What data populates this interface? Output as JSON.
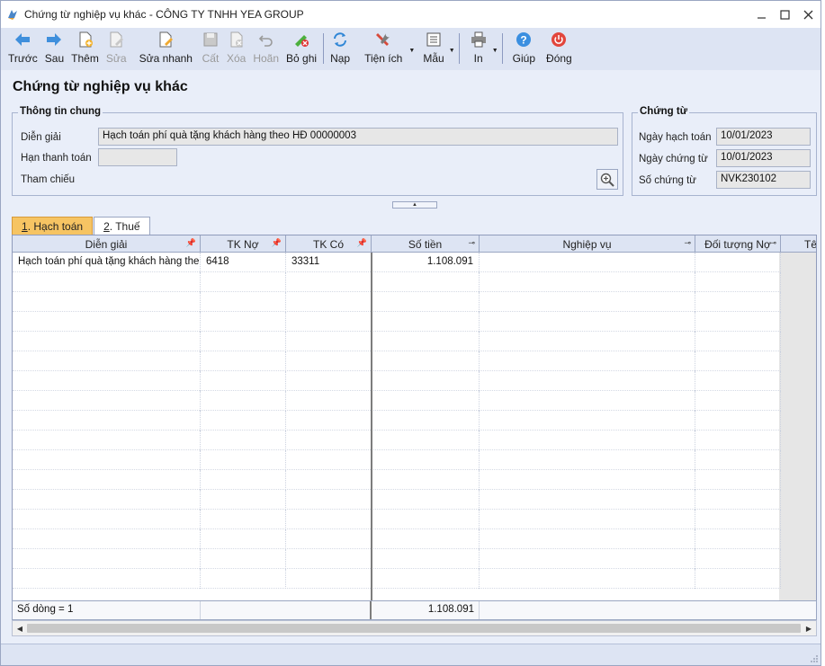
{
  "window": {
    "title": "Chứng từ nghiệp vụ khác - CÔNG TY TNHH YEA GROUP"
  },
  "toolbar": [
    {
      "key": "prev",
      "label": "Trước",
      "icon": "arrow-left-icon",
      "disabled": false
    },
    {
      "key": "next",
      "label": "Sau",
      "icon": "arrow-right-icon",
      "disabled": false
    },
    {
      "key": "add",
      "label": "Thêm",
      "icon": "new-document-icon",
      "disabled": false
    },
    {
      "key": "edit",
      "label": "Sửa",
      "icon": "edit-document-icon",
      "disabled": true
    },
    {
      "key": "quick-edit",
      "label": "Sửa nhanh",
      "icon": "quick-edit-icon",
      "disabled": false
    },
    {
      "key": "save",
      "label": "Cất",
      "icon": "save-icon",
      "disabled": true
    },
    {
      "key": "delete",
      "label": "Xóa",
      "icon": "delete-icon",
      "disabled": true
    },
    {
      "key": "undo",
      "label": "Hoãn",
      "icon": "undo-icon",
      "disabled": true
    },
    {
      "key": "unpost",
      "label": "Bỏ ghi",
      "icon": "unpost-icon",
      "disabled": false
    },
    {
      "key": "reload",
      "label": "Nạp",
      "icon": "refresh-icon",
      "disabled": false
    },
    {
      "key": "utilities",
      "label": "Tiện ích",
      "icon": "tools-icon",
      "disabled": false
    },
    {
      "key": "template",
      "label": "Mẫu",
      "icon": "template-icon",
      "disabled": false
    },
    {
      "key": "print",
      "label": "In",
      "icon": "printer-icon",
      "disabled": false
    },
    {
      "key": "help",
      "label": "Giúp",
      "icon": "help-icon",
      "disabled": false
    },
    {
      "key": "close",
      "label": "Đóng",
      "icon": "power-icon",
      "disabled": false
    }
  ],
  "page": {
    "title": "Chứng từ nghiệp vụ khác"
  },
  "general_info": {
    "legend": "Thông tin chung",
    "description_label": "Diễn giải",
    "description_value": "Hạch toán phí quà tặng khách hàng theo HĐ 00000003",
    "payment_due_label": "Hạn thanh toán",
    "payment_due_value": "",
    "reference_label": "Tham chiếu"
  },
  "voucher": {
    "legend": "Chứng từ",
    "posting_date_label": "Ngày hạch toán",
    "posting_date_value": "10/01/2023",
    "voucher_date_label": "Ngày chứng từ",
    "voucher_date_value": "10/01/2023",
    "voucher_no_label": "Số chứng từ",
    "voucher_no_value": "NVK230102"
  },
  "tabs": [
    {
      "hotkey": "1",
      "label": ". Hạch toán",
      "active": true
    },
    {
      "hotkey": "2",
      "label": ". Thuế",
      "active": false
    }
  ],
  "grid": {
    "columns": [
      "Diễn giải",
      "TK Nợ",
      "TK Có",
      "Số tiền",
      "Nghiệp vụ",
      "Đối tượng Nợ",
      "Tê"
    ],
    "rows": [
      [
        "Hạch toán phí quà tặng khách hàng the",
        "6418",
        "33311",
        "1.108.091",
        "",
        ""
      ]
    ],
    "footer": {
      "row_count": "Số dòng = 1",
      "total_amount": "1.108.091"
    }
  },
  "colors": {
    "tab_active": "#f6c463",
    "window_bg": "#dde4f3"
  }
}
